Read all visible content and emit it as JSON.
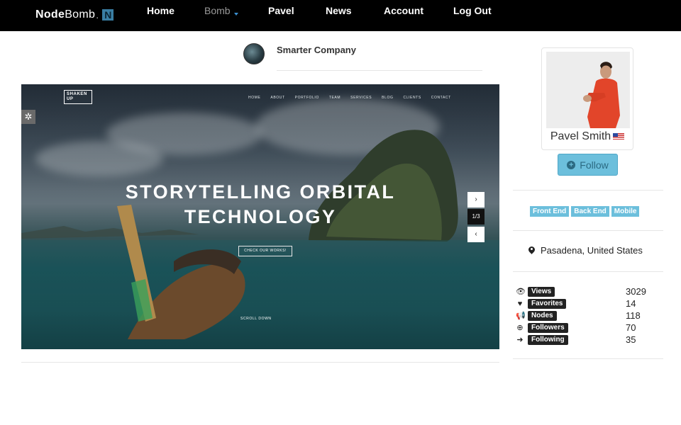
{
  "brand": {
    "name_bold": "Node",
    "name_light": "Bomb",
    "dot": ".",
    "badge": "N"
  },
  "nav": {
    "home": "Home",
    "bomb": "Bomb",
    "pavel": "Pavel",
    "news": "News",
    "account": "Account",
    "logout": "Log Out"
  },
  "company": {
    "name": "Smarter Company"
  },
  "screenshot": {
    "logo_line1": "SHAKEN",
    "logo_line2": "UP",
    "menu": [
      "HOME",
      "ABOUT",
      "PORTFOLIO",
      "TEAM",
      "SERVICES",
      "BLOG",
      "CLIENTS",
      "CONTACT"
    ],
    "title_line1": "STORYTELLING ORBITAL",
    "title_line2": "TECHNOLOGY",
    "cta": "CHECK OUR WORKS!",
    "scroll": "SCROLL DOWN",
    "slider_next": "›",
    "slider_count": "1/3",
    "slider_prev": "‹",
    "settings_icon": "gear-icon"
  },
  "profile": {
    "name": "Pavel Smith",
    "follow_label": "Follow",
    "tags": [
      "Front End",
      "Back End",
      "Mobile"
    ],
    "location": "Pasadena, United States",
    "stats": [
      {
        "icon": "👁",
        "label": "Views",
        "value": "3029"
      },
      {
        "icon": "♥",
        "label": "Favorites",
        "value": "14"
      },
      {
        "icon": "📢",
        "label": "Nodes",
        "value": "118"
      },
      {
        "icon": "⊕",
        "label": "Followers",
        "value": "70"
      },
      {
        "icon": "➜",
        "label": "Following",
        "value": "35"
      }
    ]
  },
  "colors": {
    "accent": "#6cbfdc",
    "nav_bg": "#000000",
    "badge_bg": "#222222"
  }
}
